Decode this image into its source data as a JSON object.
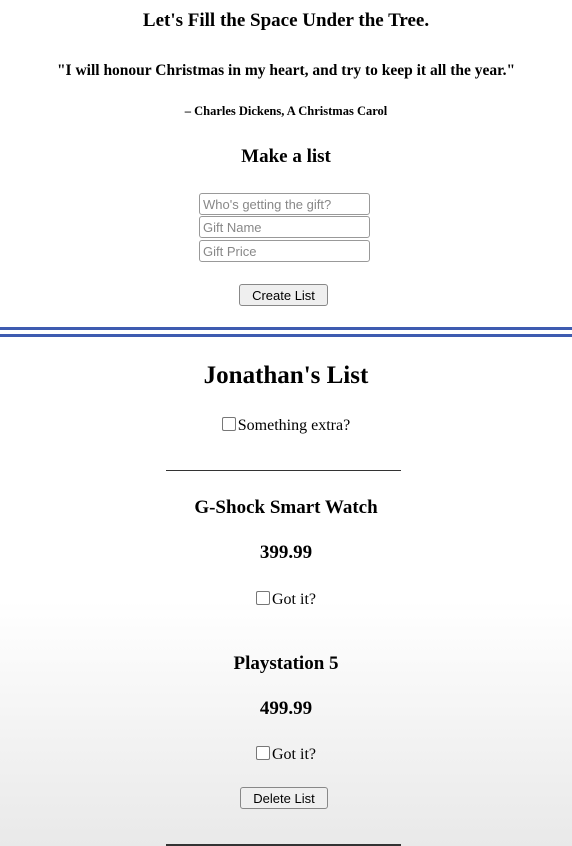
{
  "header": {
    "title": "Let's Fill the Space Under the Tree.",
    "quote": "\"I will honour Christmas in my heart, and try to keep it all the year.\"",
    "attribution": "– Charles Dickens, A Christmas Carol"
  },
  "form": {
    "heading": "Make a list",
    "recipient_placeholder": "Who's getting the gift?",
    "name_placeholder": "Gift Name",
    "price_placeholder": "Gift Price",
    "submit_label": "Create List"
  },
  "list": {
    "title": "Jonathan's List",
    "extra_label": "Something extra?",
    "items": [
      {
        "name": "G-Shock Smart Watch",
        "price": "399.99",
        "got_label": "Got it?"
      },
      {
        "name": "Playstation 5",
        "price": "499.99",
        "got_label": "Got it?"
      }
    ],
    "delete_label": "Delete List"
  },
  "colors": {
    "divider": "#3e5bb0"
  }
}
